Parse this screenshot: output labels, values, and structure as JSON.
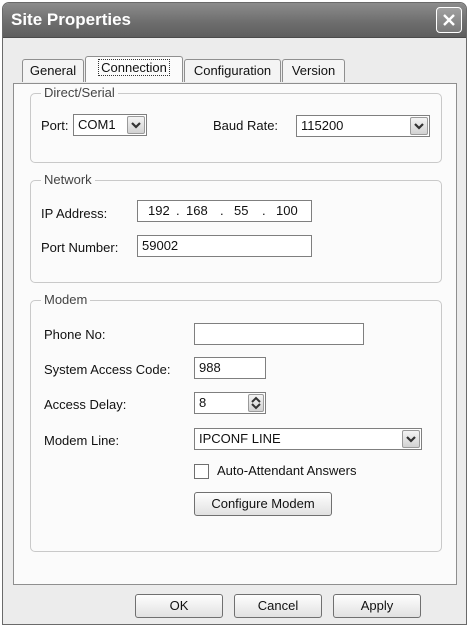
{
  "window": {
    "title": "Site Properties"
  },
  "tabs": [
    {
      "label": "General"
    },
    {
      "label": "Connection"
    },
    {
      "label": "Configuration"
    },
    {
      "label": "Version"
    }
  ],
  "direct_serial": {
    "legend": "Direct/Serial",
    "port_label": "Port:",
    "port_value": "COM1",
    "baud_label": "Baud Rate:",
    "baud_value": "115200"
  },
  "network": {
    "legend": "Network",
    "ip_label": "IP Address:",
    "ip_octets": [
      "192",
      "168",
      "55",
      "100"
    ],
    "ip_dot": ".",
    "port_label": "Port Number:",
    "port_value": "59002"
  },
  "modem": {
    "legend": "Modem",
    "phone_label": "Phone No:",
    "phone_value": "",
    "access_code_label": "System Access Code:",
    "access_code_value": "988",
    "delay_label": "Access Delay:",
    "delay_value": "8",
    "line_label": "Modem Line:",
    "line_value": "IPCONF LINE",
    "auto_attendant_label": "Auto-Attendant Answers",
    "auto_attendant_checked": false,
    "configure_label": "Configure Modem"
  },
  "footer": {
    "ok": "OK",
    "cancel": "Cancel",
    "apply": "Apply"
  }
}
